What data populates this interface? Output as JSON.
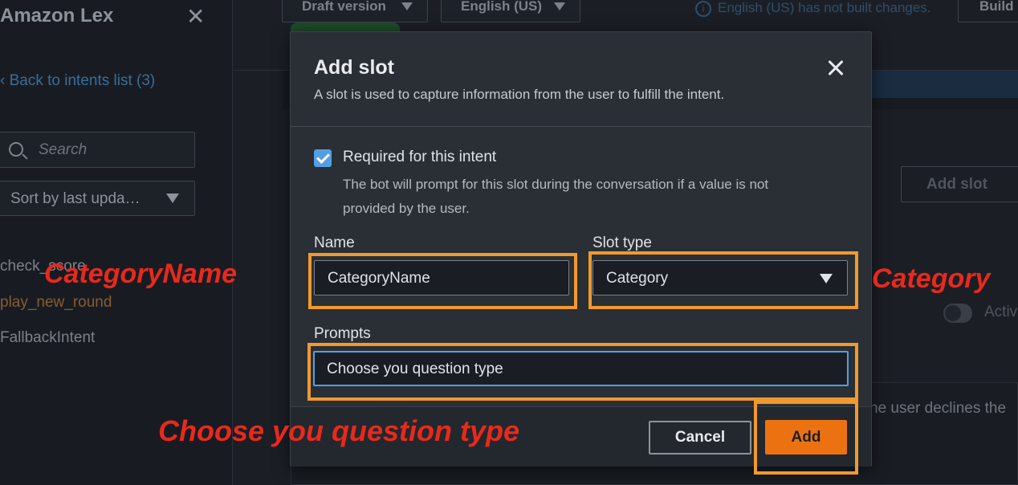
{
  "sidebar": {
    "title": "Amazon Lex",
    "back_link": "Back to intents list (3)",
    "search_placeholder": "Search",
    "sort_label": "Sort by last upda…",
    "intents": [
      "check_score",
      "play_new_round",
      "FallbackIntent"
    ]
  },
  "topbar": {
    "version_select": "Draft version",
    "language_select": "English (US)",
    "info_message": "English (US) has not built changes.",
    "build_button": "Build"
  },
  "background": {
    "add_slot_button": "Add slot",
    "active_label": "Active",
    "declines_text": "ne user declines the"
  },
  "modal": {
    "title": "Add slot",
    "description": "A slot is used to capture information from the user to fulfill the intent.",
    "required": {
      "checked": true,
      "label": "Required for this intent",
      "description": "The bot will prompt for this slot during the conversation if a value is not provided by the user."
    },
    "name_label": "Name",
    "name_value": "CategoryName",
    "slot_type_label": "Slot type",
    "slot_type_value": "Category",
    "prompts_label": "Prompts",
    "prompts_value": "Choose you question type",
    "cancel_button": "Cancel",
    "add_button": "Add"
  },
  "annotations": {
    "name": "CategoryName",
    "slot_type": "Category",
    "prompt": "Choose you question type",
    "highlight_color": "#f2992e",
    "text_color": "#e8291c"
  },
  "colors": {
    "accent_orange": "#ec7211",
    "checkbox_blue": "#539fe5",
    "modal_bg": "#2a2f36"
  }
}
